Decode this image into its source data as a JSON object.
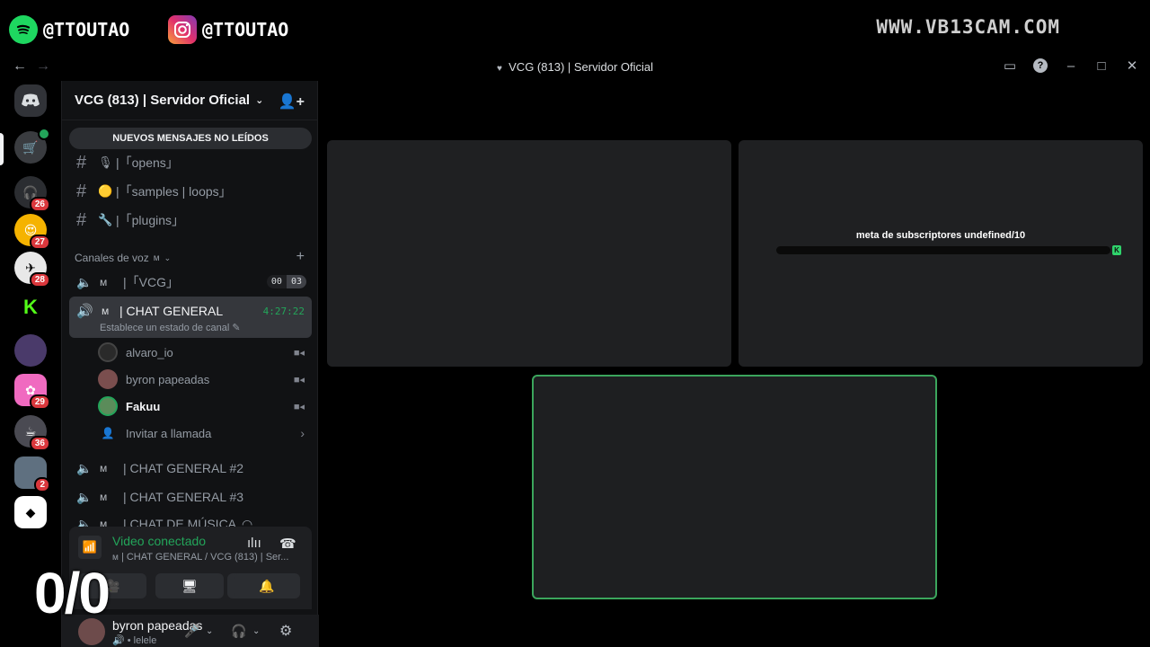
{
  "overlay": {
    "spotify_handle": "@TTOUTAO",
    "instagram_handle": "@TTOUTAO",
    "site": "WWW.VB13CAM.COM"
  },
  "window": {
    "title": "VCG (813) | Servidor Oficial"
  },
  "servers": [
    {
      "badge": ""
    },
    {
      "badge": "26"
    },
    {
      "badge": "27"
    },
    {
      "badge": "28"
    },
    {
      "badge": ""
    },
    {
      "badge": ""
    },
    {
      "badge": "29"
    },
    {
      "badge": "36"
    },
    {
      "badge": "2"
    },
    {
      "badge": ""
    }
  ],
  "sidebar": {
    "server_name": "VCG (813) | Servidor Oficial",
    "unread_banner": "NUEVOS MENSAJES NO LEÍDOS",
    "text_channels": [
      {
        "label": "|「opens」"
      },
      {
        "label": "|「samples | loops」"
      },
      {
        "label": "|「plugins」"
      }
    ],
    "voice_category": "Canales de voz",
    "voice_channels": [
      {
        "label": "|「VCG」",
        "count_a": "00",
        "count_b": "03"
      }
    ],
    "active_channel": {
      "label": "| CHAT GENERAL",
      "timer": "4:27:22",
      "status": "Establece un estado de canal"
    },
    "members": [
      {
        "name": "alvaro_io"
      },
      {
        "name": "byron papeadas"
      },
      {
        "name": "Fakuu"
      }
    ],
    "invite": "Invitar a llamada",
    "more_voice": [
      {
        "label": "| CHAT GENERAL #2"
      },
      {
        "label": "| CHAT GENERAL #3"
      },
      {
        "label": "| CHAT DE MÚSICA"
      }
    ]
  },
  "rtc": {
    "title": "Video conectado",
    "subtitle": "| CHAT GENERAL / VCG (813) | Ser..."
  },
  "counter_overlay": "0/0",
  "user": {
    "name": "byron papeadas",
    "status": "lelele"
  },
  "stage": {
    "meta_label": "meta de subscriptores undefined/10",
    "meta_icon_label": "K",
    "meta_progress": 0.0
  },
  "colors": {
    "accent_green": "#23a55a",
    "active_border": "#3ba55c",
    "badge_red": "#da373c"
  }
}
